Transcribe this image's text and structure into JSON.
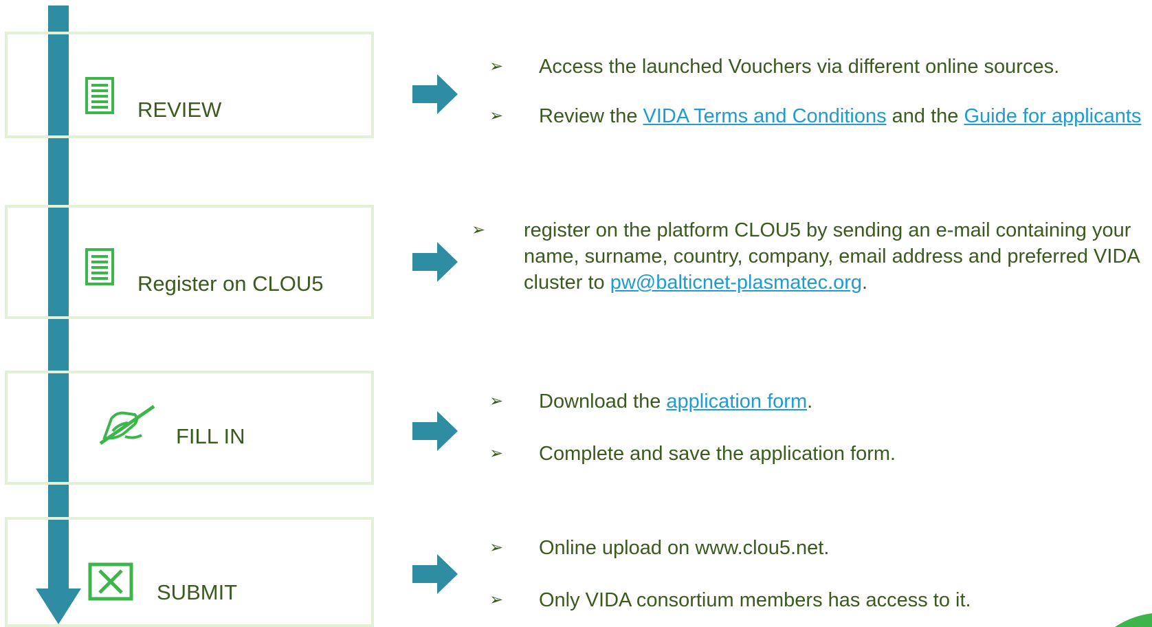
{
  "steps": [
    {
      "label": "REVIEW",
      "icon": "document-icon"
    },
    {
      "label": "Register on CLOU5",
      "icon": "document-icon"
    },
    {
      "label": "FILL IN",
      "icon": "pen-writing-icon"
    },
    {
      "label": "SUBMIT",
      "icon": "checkbox-x-icon"
    }
  ],
  "review": {
    "bullet1": "Access the launched Vouchers via different online sources.",
    "bullet2_prefix": "Review the ",
    "bullet2_link1": "VIDA Terms and Conditions",
    "bullet2_mid": " and the ",
    "bullet2_link2": "Guide for applicants"
  },
  "register": {
    "text": "register on the platform CLOU5 by sending an e-mail containing your name, surname, country, company, email address and preferred VIDA cluster to ",
    "email_link": "pw@balticnet-plasmatec.org",
    "suffix": "."
  },
  "fill_in": {
    "bullet1_prefix": "Download the ",
    "bullet1_link": "application form",
    "bullet1_suffix": ".",
    "bullet2": "Complete and save the application form."
  },
  "submit": {
    "bullet1": "Online upload on www.clou5.net.",
    "bullet2": "Only VIDA consortium members has access to it."
  },
  "bullet_marker": "➢",
  "colors": {
    "timeline": "#2e8ca3",
    "box_border": "#e4f0d6",
    "text": "#3a5a1e",
    "link": "#1f9bd1",
    "icon_green": "#3cb54a"
  }
}
